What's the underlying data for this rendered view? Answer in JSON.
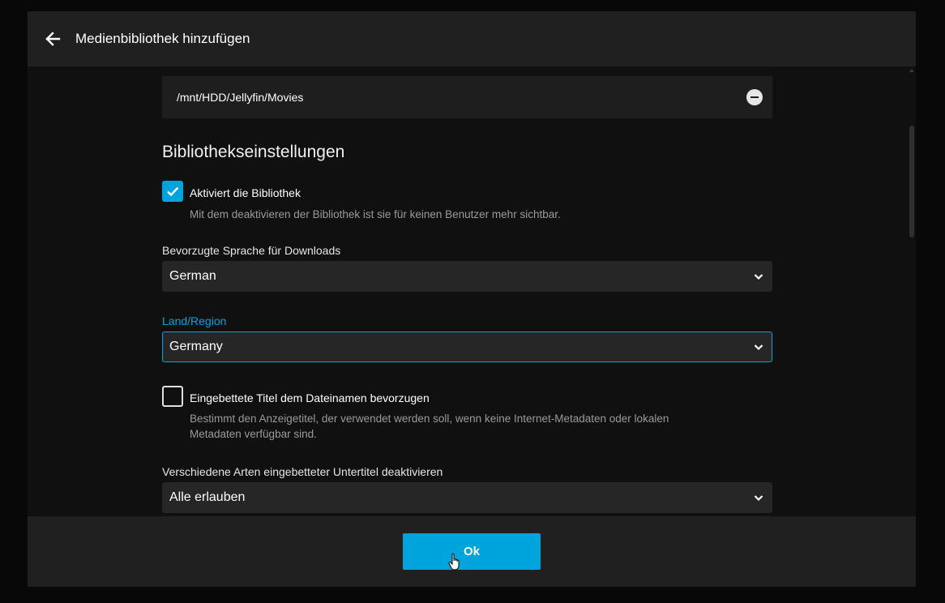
{
  "header": {
    "title": "Medienbibliothek hinzufügen",
    "back_icon": "arrow-left-icon"
  },
  "folder": {
    "path": "/mnt/HDD/Jellyfin/Movies",
    "remove_icon": "minus-circle-icon"
  },
  "settings": {
    "section_title": "Bibliothekseinstellungen",
    "enable_library": {
      "label": "Aktiviert die Bibliothek",
      "checked": true,
      "help": "Mit dem deaktivieren der Bibliothek ist sie für keinen Benutzer mehr sichtbar."
    },
    "preferred_language": {
      "label": "Bevorzugte Sprache für Downloads",
      "value": "German"
    },
    "country": {
      "label": "Land/Region",
      "value": "Germany"
    },
    "prefer_embedded_titles": {
      "label": "Eingebettete Titel dem Dateinamen bevorzugen",
      "checked": false,
      "help_line1": "Bestimmt den Anzeigetitel, der verwendet werden soll, wenn keine Internet-Metadaten oder lokalen",
      "help_line2": "Metadaten verfügbar sind."
    },
    "disable_embedded_subtitles": {
      "label": "Verschiedene Arten eingebetteter Untertitel deaktivieren",
      "value": "Alle erlauben"
    }
  },
  "footer": {
    "ok_label": "Ok"
  },
  "colors": {
    "accent": "#00a4dc",
    "header_bg": "#202020",
    "content_bg": "#101010",
    "input_bg": "#262626"
  }
}
